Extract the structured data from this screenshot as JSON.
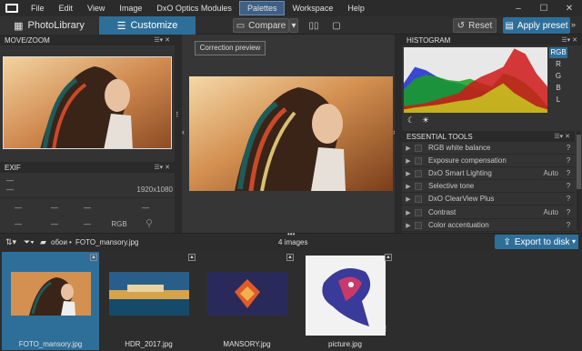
{
  "menubar": {
    "items": [
      "File",
      "Edit",
      "View",
      "Image",
      "DxO Optics Modules",
      "Palettes",
      "Workspace",
      "Help"
    ],
    "active": "Palettes"
  },
  "toolbar": {
    "photo_library": "PhotoLibrary",
    "customize": "Customize",
    "compare": "Compare",
    "reset": "Reset",
    "apply_preset": "Apply preset"
  },
  "left_panel": {
    "move_zoom_title": "MOVE/ZOOM",
    "exif_title": "EXIF",
    "exif_dash1": "—",
    "exif_dash2": "—",
    "exif_resolution": "1920x1080",
    "exif_colorspace": "RGB",
    "exif_cells": [
      "—",
      "—",
      "—",
      "—",
      "—"
    ]
  },
  "center": {
    "correction_preview": "Correction preview"
  },
  "right_panel": {
    "histogram_title": "HISTOGRAM",
    "channels": [
      "RGB",
      "R",
      "G",
      "B",
      "L"
    ],
    "essential_tools_title": "ESSENTIAL TOOLS",
    "tools": [
      {
        "name": "RGB white balance",
        "value": ""
      },
      {
        "name": "Exposure compensation",
        "value": ""
      },
      {
        "name": "DxO Smart Lighting",
        "value": "Auto"
      },
      {
        "name": "Selective tone",
        "value": ""
      },
      {
        "name": "DxO ClearView Plus",
        "value": ""
      },
      {
        "name": "Contrast",
        "value": "Auto"
      },
      {
        "name": "Color accentuation",
        "value": ""
      }
    ]
  },
  "filmstrip": {
    "folder": "обои",
    "file": "FOTO_mansory.jpg",
    "count": "4 images",
    "export": "Export to disk",
    "thumbs": [
      "FOTO_mansory.jpg",
      "HDR_2017.jpg",
      "MANSORY.jpg",
      "picture.jpg"
    ]
  },
  "colors": {
    "accent": "#2e6f9a",
    "menu_active": "#3f5f84"
  },
  "histogram_data": {
    "red": [
      0.1,
      0.12,
      0.15,
      0.2,
      0.25,
      0.3,
      0.45,
      0.55,
      0.62,
      0.7,
      0.98,
      0.9,
      0.6,
      0.4
    ],
    "green": [
      0.35,
      0.52,
      0.58,
      0.55,
      0.5,
      0.48,
      0.52,
      0.45,
      0.4,
      0.6,
      0.55,
      0.45,
      0.3,
      0.1
    ],
    "blue": [
      0.45,
      0.7,
      0.65,
      0.55,
      0.48,
      0.45,
      0.4,
      0.35,
      0.3,
      0.25,
      0.2,
      0.12,
      0.08,
      0.04
    ],
    "yellow": [
      0.05,
      0.08,
      0.1,
      0.12,
      0.15,
      0.18,
      0.2,
      0.25,
      0.35,
      0.45,
      0.3,
      0.2,
      0.1,
      0.05
    ]
  }
}
